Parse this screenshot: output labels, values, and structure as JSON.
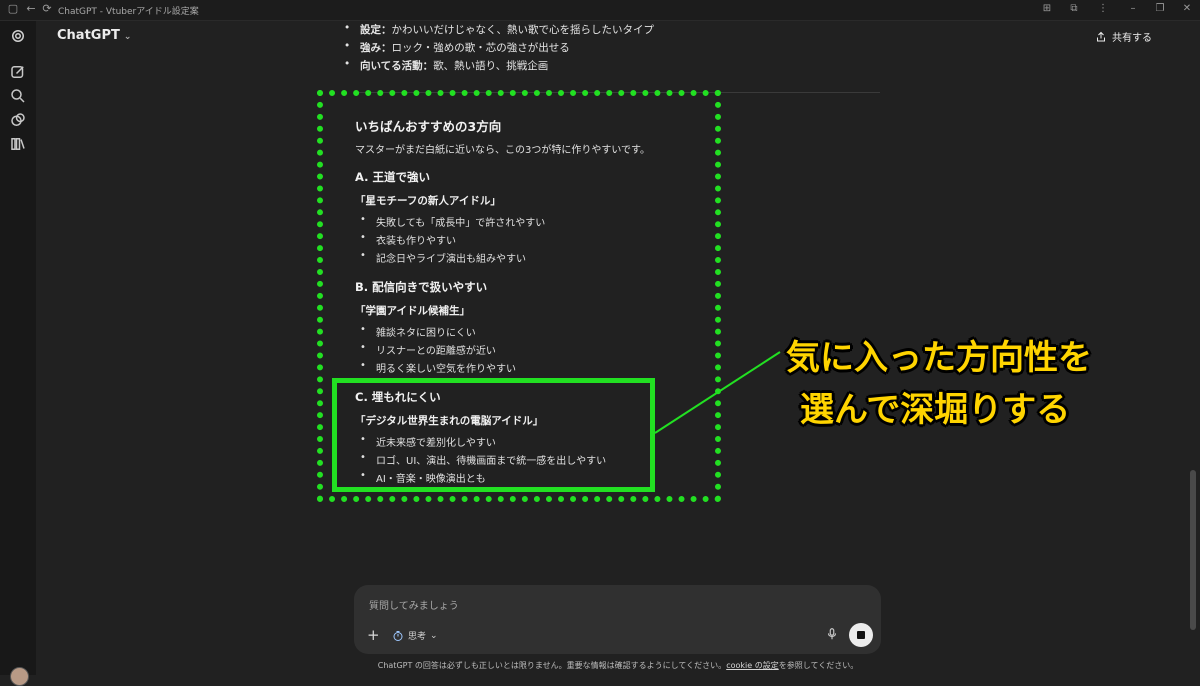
{
  "window": {
    "title": "ChatGPT - Vtuberアイドル設定案",
    "back": "←",
    "reload": "⟳"
  },
  "header": {
    "brand": "ChatGPT",
    "brand_chevron": "⌄",
    "share_label": "共有する"
  },
  "chat": {
    "top_bullets": [
      {
        "key": "設定：",
        "text": "かわいいだけじゃなく、熱い歌で心を揺らしたいタイプ"
      },
      {
        "key": "強み：",
        "text": "ロック・強めの歌・芯の強さが出せる"
      },
      {
        "key": "向いてる活動：",
        "text": "歌、熱い語り、挑戦企画"
      }
    ],
    "heading": "いちばんおすすめの3方向",
    "intro": "マスターがまだ白紙に近いなら、この3つが特に作りやすいです。",
    "options": [
      {
        "title": "A. 王道で強い",
        "subtitle": "「星モチーフの新人アイドル」",
        "items": [
          "失敗しても「成長中」で許されやすい",
          "衣装も作りやすい",
          "記念日やライブ演出も組みやすい"
        ]
      },
      {
        "title": "B. 配信向きで扱いやすい",
        "subtitle": "「学園アイドル候補生」",
        "items": [
          "雑談ネタに困りにくい",
          "リスナーとの距離感が近い",
          "明るく楽しい空気を作りやすい"
        ]
      },
      {
        "title": "C. 埋もれにくい",
        "subtitle": "「デジタル世界生まれの電脳アイドル」",
        "items": [
          "近未来感で差別化しやすい",
          "ロゴ、UI、演出、待機画面まで統一感を出しやすい",
          "AI・音楽・映像演出とも"
        ]
      }
    ]
  },
  "callout": {
    "line1": "気に入った方向性を",
    "line2": "選んで深堀りする",
    "color": "#ffd400",
    "box_color": "#22e022"
  },
  "composer": {
    "placeholder": "質問してみましょう",
    "plus": "+",
    "mode_label": "思考",
    "mode_chevron": "⌄"
  },
  "disclaimer": {
    "text_before": "ChatGPT の回答は必ずしも正しいとは限りません。重要な情報は確認するようにしてください。",
    "link": "cookie の設定",
    "text_after": "を参照してください。"
  },
  "icons": {
    "rail": [
      "openai-logo-icon",
      "new-chat-icon",
      "search-icon",
      "images-icon",
      "library-icon"
    ],
    "share": "share-icon",
    "composer": [
      "plus-icon",
      "timer-icon",
      "mic-icon",
      "stop-icon"
    ]
  }
}
